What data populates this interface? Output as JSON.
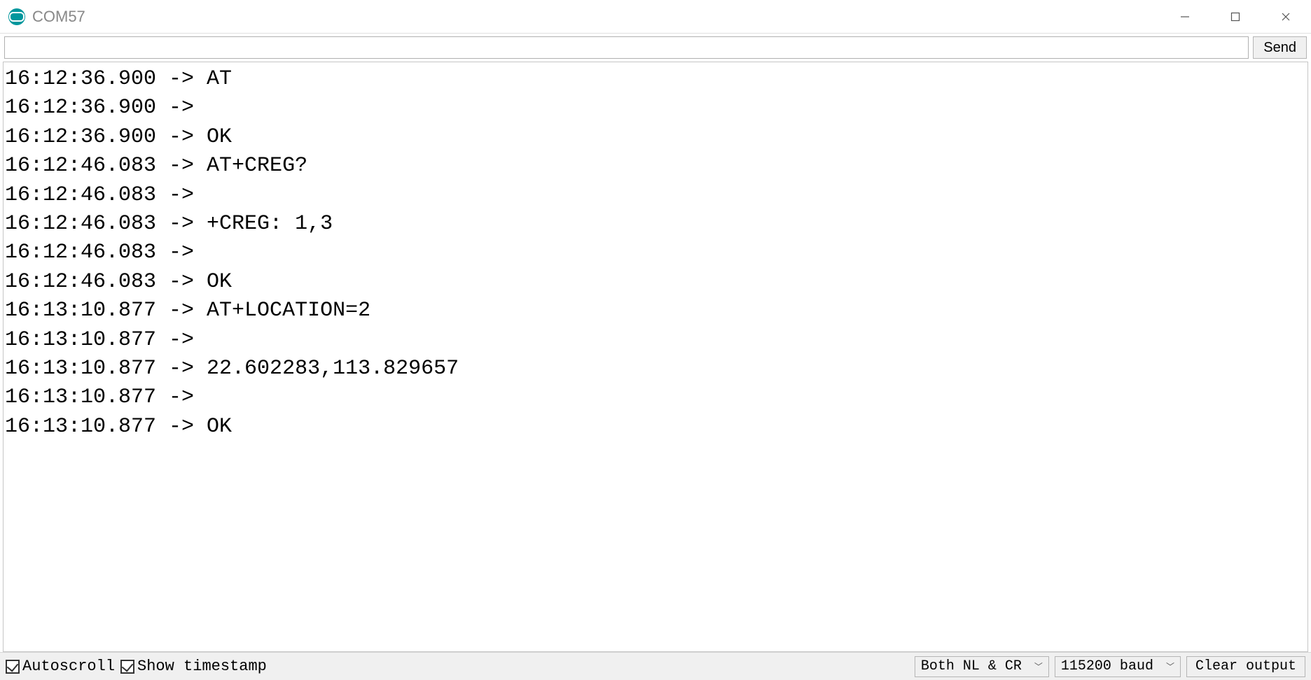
{
  "window": {
    "title": "COM57"
  },
  "toolbar": {
    "input_value": "",
    "send_label": "Send"
  },
  "log_lines": [
    "16:12:36.900 -> AT",
    "16:12:36.900 -> ",
    "16:12:36.900 -> OK",
    "16:12:46.083 -> AT+CREG?",
    "16:12:46.083 -> ",
    "16:12:46.083 -> +CREG: 1,3",
    "16:12:46.083 -> ",
    "16:12:46.083 -> OK",
    "16:13:10.877 -> AT+LOCATION=2",
    "16:13:10.877 -> ",
    "16:13:10.877 -> 22.602283,113.829657",
    "16:13:10.877 -> ",
    "16:13:10.877 -> OK"
  ],
  "status": {
    "autoscroll_label": "Autoscroll",
    "autoscroll_checked": true,
    "timestamp_label": "Show timestamp",
    "timestamp_checked": true,
    "line_ending_selected": "Both NL & CR",
    "baud_selected": "115200 baud",
    "clear_label": "Clear output"
  }
}
